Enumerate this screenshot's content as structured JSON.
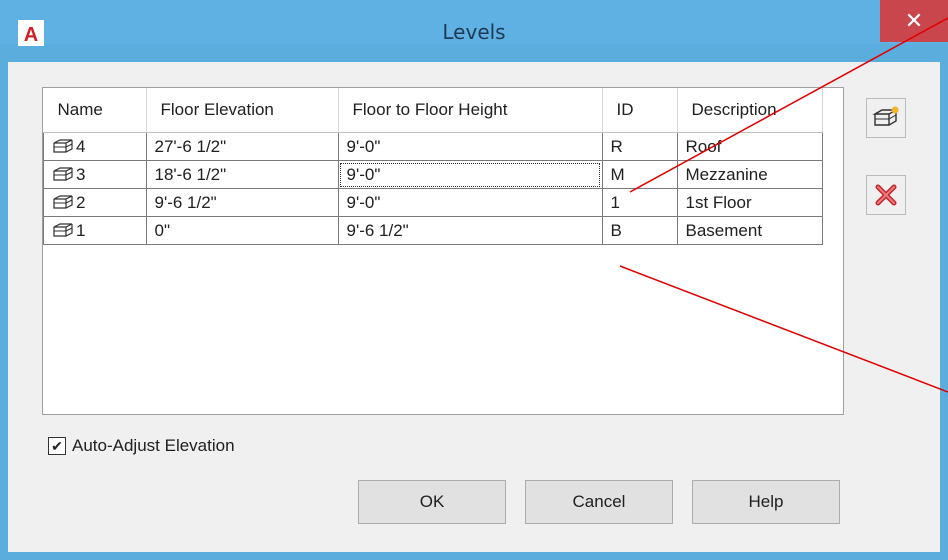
{
  "window": {
    "title": "Levels",
    "close_glyph": "✕",
    "logo_letter": "A"
  },
  "grid": {
    "columns": [
      "Name",
      "Floor Elevation",
      "Floor to Floor Height",
      "ID",
      "Description"
    ],
    "rows": [
      {
        "name": "4",
        "floor_elevation": "27'-6 1/2\"",
        "floor_to_floor": "9'-0\"",
        "id": "R",
        "description": "Roof"
      },
      {
        "name": "3",
        "floor_elevation": "18'-6 1/2\"",
        "floor_to_floor": "9'-0\"",
        "id": "M",
        "description": "Mezzanine"
      },
      {
        "name": "2",
        "floor_elevation": "9'-6 1/2\"",
        "floor_to_floor": "9'-0\"",
        "id": "1",
        "description": "1st Floor"
      },
      {
        "name": "1",
        "floor_elevation": "0\"",
        "floor_to_floor": "9'-6 1/2\"",
        "id": "B",
        "description": "Basement"
      }
    ]
  },
  "toolbar": {
    "add_icon": "add-level-icon",
    "delete_icon": "delete-level-icon"
  },
  "options": {
    "auto_adjust_label": "Auto-Adjust Elevation",
    "auto_adjust_checked": true
  },
  "buttons": {
    "ok": "OK",
    "cancel": "Cancel",
    "help": "Help"
  },
  "colors": {
    "title_bar": "#5eb1e2",
    "close_button": "#c9474c",
    "annotation_line": "#e00000",
    "delete_x": "#c0282d"
  }
}
